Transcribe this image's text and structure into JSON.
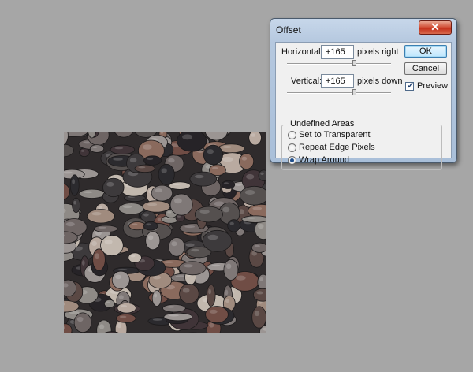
{
  "dialog": {
    "title": "Offset",
    "close_label": "✕",
    "horizontal": {
      "label": "Horizontal:",
      "value": "+165",
      "unit": "pixels right"
    },
    "vertical": {
      "label": "Vertical:",
      "value": "+165",
      "unit": "pixels down"
    },
    "ok_label": "OK",
    "cancel_label": "Cancel",
    "preview": {
      "label": "Preview",
      "checked": true
    },
    "undefined_areas": {
      "title": "Undefined Areas",
      "options": [
        {
          "label": "Set to Transparent",
          "selected": false
        },
        {
          "label": "Repeat Edge Pixels",
          "selected": false
        },
        {
          "label": "Wrap Around",
          "selected": true
        }
      ]
    }
  },
  "colors": {
    "canvas_bg": "#a6a6a6",
    "close_button": "#c4301b",
    "ok_button": "#bee6fd"
  }
}
